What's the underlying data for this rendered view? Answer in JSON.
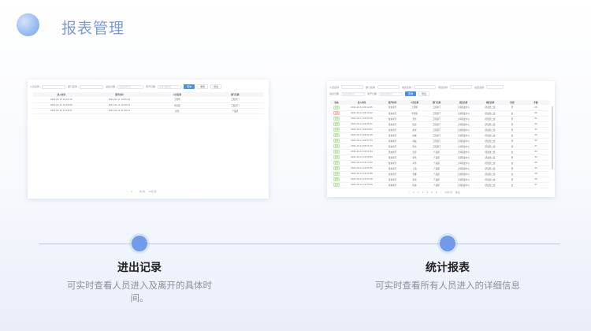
{
  "page": {
    "title": "报表管理"
  },
  "colors": {
    "accent": "#6f9be8",
    "primary_button": "#4a90e2",
    "title": "#7b9ad6"
  },
  "left_panel": {
    "filters": {
      "name_label": "人员名称",
      "dept_label": "部门名称",
      "entry_label": "进出日期",
      "exit_label": "离开日期",
      "date_placeholder": "选择日期时间"
    },
    "buttons": {
      "search": "查询",
      "reset": "重置",
      "export": "导出"
    },
    "columns": [
      "进入时间",
      "离开时间",
      "人员名称",
      "部门名称"
    ],
    "rows": [
      [
        "2021-01-11 10:24:16",
        "2021-01-11 10:45:16",
        "王晓明",
        "工程部门"
      ],
      [
        "2021-01-11 10:30:08",
        "2021-01-11 10:56:23",
        "李思雨",
        "工程部门"
      ],
      [
        "2021-01-11 11:02:37",
        "2021-01-11 11:40:21",
        "张伟",
        "产品部"
      ]
    ],
    "pager": {
      "prev": "‹",
      "page": "1",
      "next": "›",
      "total": "共3条",
      "size": "10条/页"
    }
  },
  "right_panel": {
    "filters": {
      "name_label": "人员名称",
      "dept_label": "部门名称",
      "region_label": "地区名称",
      "project_label": "项目名称",
      "status_label": "是否违规",
      "entry_label": "进出日期",
      "exit_label": "离开日期",
      "date_placeholder": "选择日期时间"
    },
    "buttons": {
      "search": "查询",
      "export": "导出"
    },
    "columns": [
      "状态",
      "进入时间",
      "离开时间",
      "人员名称",
      "部门名称",
      "项目名称",
      "地区名称",
      "性别",
      "年龄"
    ],
    "rows": [
      [
        "正常",
        "2021-01-11 09:12:45",
        "暂未离开",
        "王晓明",
        "工程部门",
        "上海研发中心",
        "研发部二组",
        "男",
        "28"
      ],
      [
        "违规",
        "2021-01-11 09:15:02",
        "暂未离开",
        "李思雨",
        "工程部门",
        "上海研发中心",
        "研发部二组",
        "女",
        "26"
      ],
      [
        "正常",
        "2021-01-11 09:20:18",
        "暂未离开",
        "张伟",
        "工程部门",
        "上海研发中心",
        "研发部二组",
        "男",
        "31"
      ],
      [
        "正常",
        "2021-01-11 09:28:41",
        "暂未离开",
        "陈晨",
        "工程部门",
        "上海研发中心",
        "研发部二组",
        "男",
        "29"
      ],
      [
        "正常",
        "2021-01-11 09:33:07",
        "暂未离开",
        "刘洋",
        "工程部门",
        "上海研发中心",
        "研发部二组",
        "男",
        "33"
      ],
      [
        "正常",
        "2021-01-11 09:41:26",
        "暂未离开",
        "赵敏",
        "工程部门",
        "上海研发中心",
        "研发部二组",
        "女",
        "25"
      ],
      [
        "正常",
        "2021-01-11 09:47:53",
        "暂未离开",
        "孙磊",
        "工程部门",
        "上海研发中心",
        "研发部二组",
        "男",
        "30"
      ],
      [
        "正常",
        "2021-01-11 09:52:10",
        "暂未离开",
        "周杰",
        "工程部门",
        "上海研发中心",
        "研发部二组",
        "男",
        "27"
      ],
      [
        "正常",
        "2021-01-11 10:01:34",
        "暂未离开",
        "吴婷",
        "产品部",
        "上海研发中心",
        "研发部二组",
        "女",
        "24"
      ],
      [
        "正常",
        "2021-01-11 10:08:49",
        "暂未离开",
        "郑浩",
        "产品部",
        "上海研发中心",
        "研发部二组",
        "男",
        "32"
      ],
      [
        "正常",
        "2021-01-11 10:14:22",
        "暂未离开",
        "冯雪",
        "产品部",
        "上海研发中心",
        "研发部二组",
        "女",
        "26"
      ],
      [
        "正常",
        "2021-01-11 10:21:05",
        "暂未离开",
        "王强",
        "产品部",
        "上海研发中心",
        "研发部二组",
        "男",
        "35"
      ],
      [
        "正常",
        "2021-01-11 10:27:38",
        "暂未离开",
        "李娜",
        "产品部",
        "上海研发中心",
        "研发部二组",
        "女",
        "28"
      ],
      [
        "正常",
        "2021-01-11 10:33:16",
        "暂未离开",
        "张涛",
        "产品部",
        "上海研发中心",
        "研发部二组",
        "男",
        "29"
      ],
      [
        "正常",
        "2021-01-11 10:39:50",
        "暂未离开",
        "陈静",
        "产品部",
        "上海研发中心",
        "研发部二组",
        "女",
        "27"
      ]
    ],
    "pager": {
      "prev": "‹",
      "pages": [
        "1",
        "2",
        "3",
        "4",
        "5",
        "6"
      ],
      "next": "›",
      "size": "10条/页",
      "goto": "前往"
    }
  },
  "timeline": {
    "left": {
      "title": "进出记录",
      "desc": "可实时查看人员进入及离开的具体时间。"
    },
    "right": {
      "title": "统计报表",
      "desc": "可实时查看所有人员进入的详细信息"
    }
  }
}
